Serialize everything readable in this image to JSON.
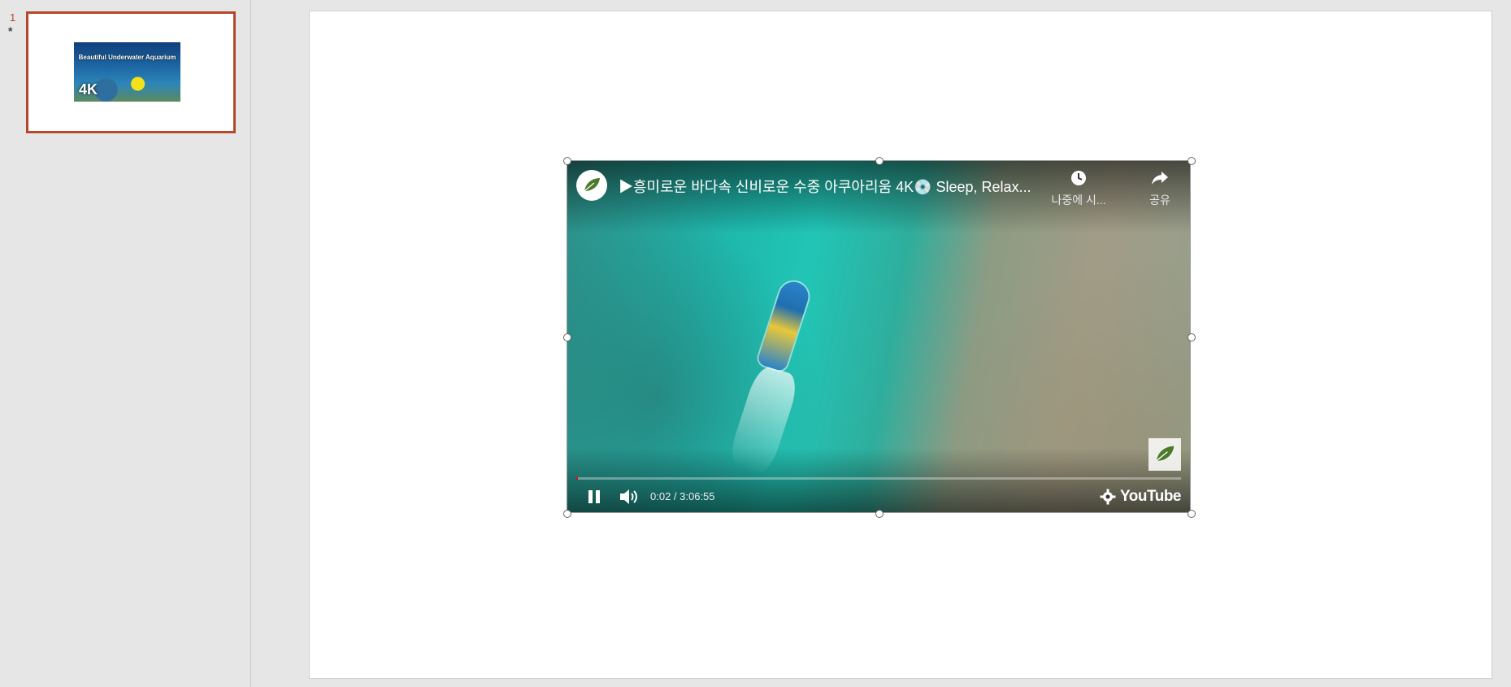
{
  "thumbnail_panel": {
    "slide_number": "1",
    "slide_marker": "*",
    "thumbnail": {
      "title": "Beautiful Underwater Aquarium",
      "badge": "4K"
    }
  },
  "video": {
    "title": "▶흥미로운 바다속 신비로운 수중 아쿠아리움 4K💿 Sleep, Relax...",
    "watch_later_label": "나중에 시...",
    "share_label": "공유",
    "time": "0:02 / 3:06:55",
    "progress": 0.0002,
    "brand": "YouTube",
    "channel_logo_text": "NATURE"
  },
  "colors": {
    "selection_accent": "#b7472a",
    "progress_red": "#ff0000"
  }
}
